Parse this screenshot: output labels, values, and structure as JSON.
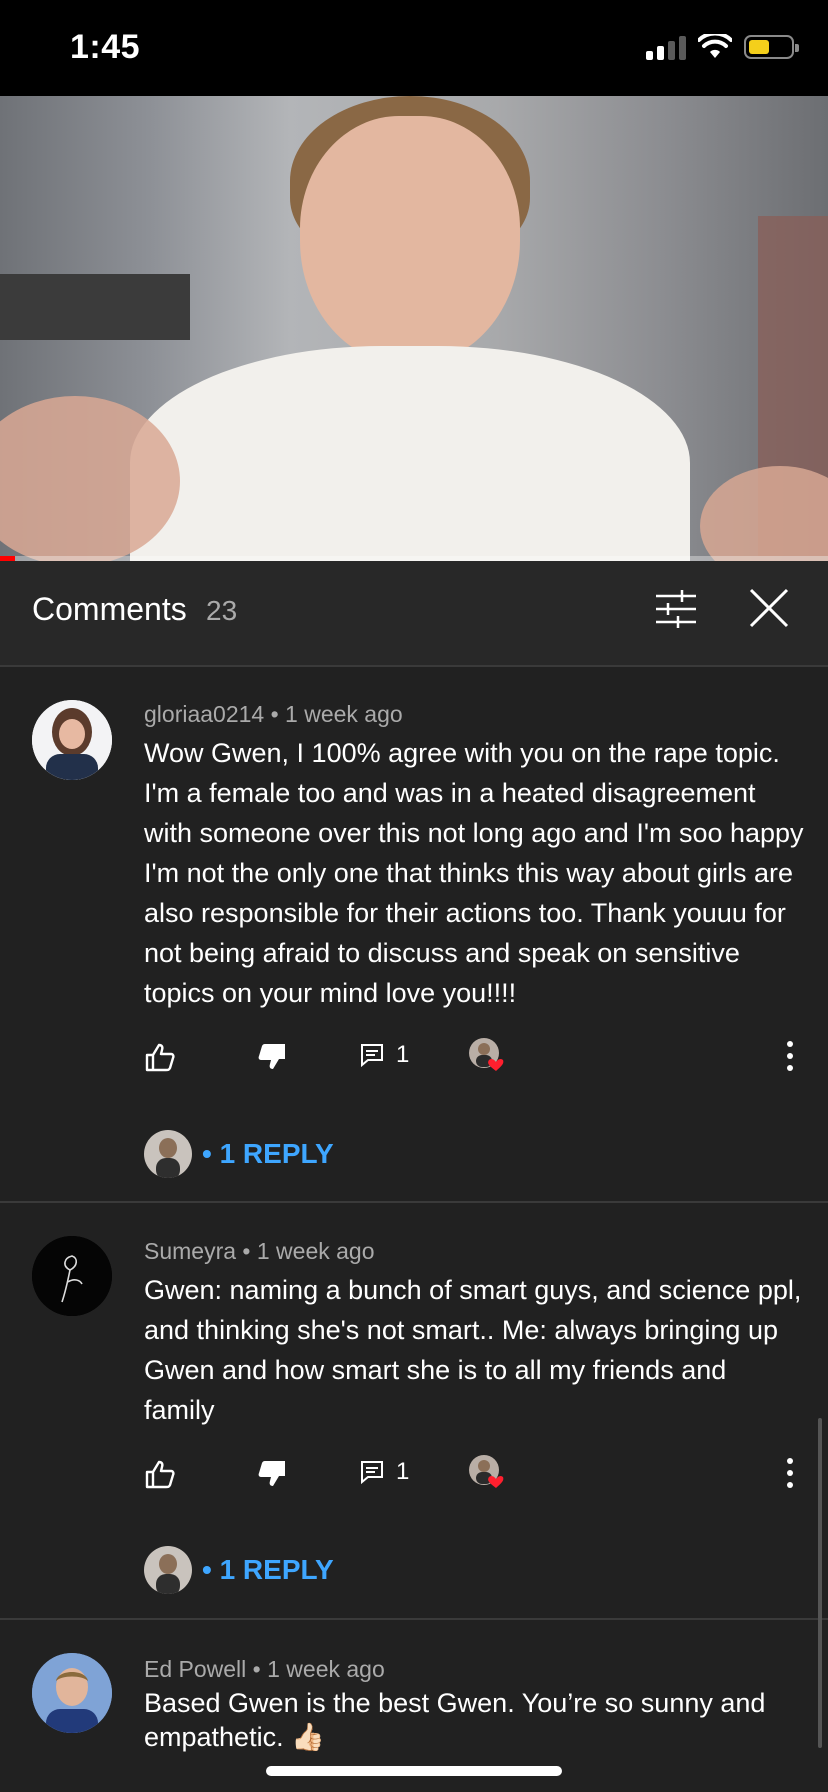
{
  "status_bar": {
    "time": "1:45"
  },
  "video": {
    "progress_fraction": 0.018
  },
  "comments_panel": {
    "title": "Comments",
    "count": "23"
  },
  "comments": [
    {
      "author": "gloriaa0214",
      "age": "1 week ago",
      "meta": "gloriaa0214 • 1 week ago",
      "text": "Wow Gwen, I 100% agree with you on the rape topic. I'm a female too and was in a heated disagreement with someone over this not long ago and I'm soo happy I'm not the only one that thinks this way about girls are also responsible for their actions too. Thank youuu for not being afraid to discuss and speak on sensitive topics on your mind love you!!!!",
      "reply_count": "1",
      "replies_link": "• 1 REPLY"
    },
    {
      "author": "Sumeyra",
      "age": "1 week ago",
      "meta": "Sumeyra • 1 week ago",
      "text": "Gwen: naming a bunch of smart guys, and science ppl, and thinking she's not smart.. Me: always bringing up Gwen and how smart she is to all my friends and family",
      "reply_count": "1",
      "replies_link": "• 1 REPLY"
    },
    {
      "author": "Ed Powell",
      "age": "1 week ago",
      "meta": "Ed Powell • 1 week ago",
      "text": "Based Gwen is the best Gwen.  You’re so sunny and empathetic. 👍🏻"
    }
  ],
  "colors": {
    "accent_link": "#3ea6ff",
    "progress": "#ff0000",
    "heart": "#ff0000"
  },
  "icons": [
    "like-icon",
    "dislike-icon",
    "reply-icon",
    "creator-heart-icon",
    "more-vert-icon",
    "filter-icon",
    "close-icon"
  ]
}
